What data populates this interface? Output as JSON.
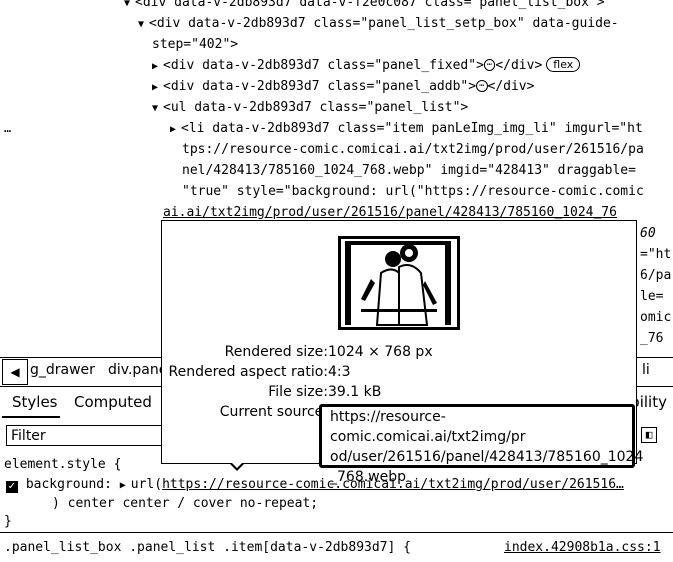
{
  "dom_lines": [
    "<div data-v-2db893d7 data-v-f2e0c087 class=\"panel_list_box\">",
    "<div data-v-2db893d7 class=\"panel_list_setp_box\" data-guide-",
    "step=\"402\">",
    "<div data-v-2db893d7 class=\"panel_fixed\">",
    "</div>",
    "flex",
    "<div data-v-2db893d7 class=\"panel_addb\">",
    "</div>",
    "<ul data-v-2db893d7 class=\"panel_list\">",
    "<li data-v-2db893d7 class=\"item panLeImg_img_li\" imgurl=\"ht",
    "tps://resource-comic.comicai.ai/txt2img/prod/user/261516/pa",
    "nel/428413/785160_1024_768.webp\" imgid=\"428413\" draggable=",
    "\"true\" style=\"background: url(\"https://resource-comic.comic",
    "ai.ai/txt2img/prod/user/261516/panel/428413/785160_1024_76"
  ],
  "dom_fragments_right": [
    "60",
    "=\"ht",
    "6/pa",
    "le=",
    "omic",
    "_76"
  ],
  "gutter_ellipsis": "…",
  "ellipsis_glyph": "⋯",
  "breadcrumbs": {
    "back_arrow": "◀",
    "items": [
      "g_drawer",
      "div.pane"
    ],
    "right_item": "li"
  },
  "tabs": {
    "styles": "Styles",
    "computed": "Computed",
    "right_partial": "ibility"
  },
  "filter": {
    "placeholder": "Filter"
  },
  "styles_pane": {
    "element_style": "element.style {",
    "prop_name": "background",
    "prop_url_fn": "url(",
    "prop_url": "https://resource-comic.comicai.ai/txt2img/prod/user/261516…",
    "prop_rest": ") center center / cover no-repeat;",
    "close_brace": "}",
    "selector": ".panel_list_box .panel_list .item[data-v-2db893d7] {",
    "source_link": "index.42908b1a.css:1"
  },
  "tooltip": {
    "rendered_size_label": "Rendered size:",
    "rendered_size_value": "1024 × 768 px",
    "aspect_label": "Rendered aspect ratio:",
    "aspect_value": "4:3",
    "file_size_label": "File size:",
    "file_size_value": "39.1 kB",
    "current_source_label": "Current source:",
    "current_source_lines": [
      "https://resource-comic.comicai.ai/txt2img/pr",
      "od/user/261516/panel/428413/785160_1024",
      "_768.webp"
    ]
  }
}
